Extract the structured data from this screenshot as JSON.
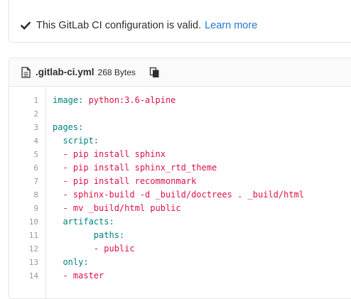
{
  "validation": {
    "message": "This GitLab CI configuration is valid.",
    "link_label": "Learn more"
  },
  "file": {
    "name": ".gitlab-ci.yml",
    "size": "268 Bytes"
  },
  "code": {
    "line_numbers": [
      "1",
      "2",
      "3",
      "4",
      "5",
      "6",
      "7",
      "8",
      "9",
      "10",
      "11",
      "12",
      "13",
      "14"
    ],
    "lines": [
      {
        "indent": "",
        "key": "image:",
        "value": " python:3.6-alpine"
      },
      {
        "indent": "",
        "key": "",
        "value": ""
      },
      {
        "indent": "",
        "key": "pages:",
        "value": ""
      },
      {
        "indent": "  ",
        "key": "script:",
        "value": ""
      },
      {
        "indent": "  ",
        "key": "",
        "value": "- pip install sphinx"
      },
      {
        "indent": "  ",
        "key": "",
        "value": "- pip install sphinx_rtd_theme"
      },
      {
        "indent": "  ",
        "key": "",
        "value": "- pip install recommonmark"
      },
      {
        "indent": "  ",
        "key": "",
        "value": "- sphinx-build -d _build/doctrees . _build/html"
      },
      {
        "indent": "  ",
        "key": "",
        "value": "- mv _build/html public"
      },
      {
        "indent": "  ",
        "key": "artifacts:",
        "value": ""
      },
      {
        "indent": "        ",
        "key": "paths:",
        "value": ""
      },
      {
        "indent": "        ",
        "key": "",
        "value": "- public"
      },
      {
        "indent": "  ",
        "key": "only:",
        "value": ""
      },
      {
        "indent": "  ",
        "key": "",
        "value": "- master"
      }
    ]
  }
}
